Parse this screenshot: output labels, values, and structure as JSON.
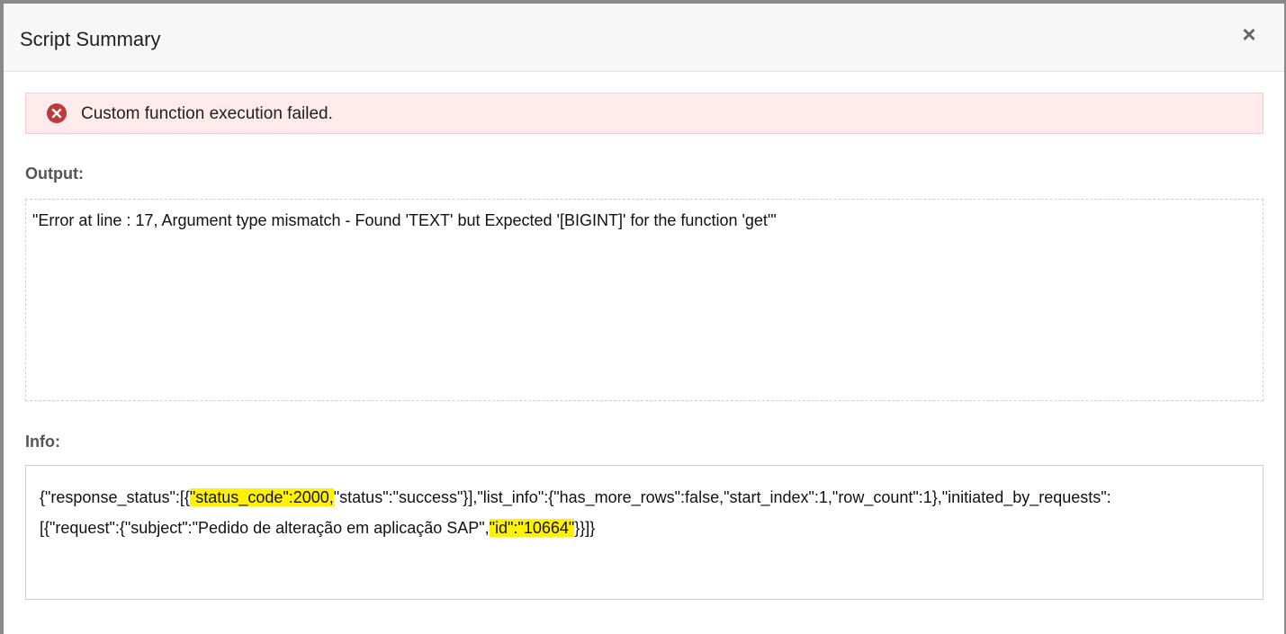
{
  "dialog": {
    "title": "Script Summary",
    "close_label": "×"
  },
  "alert": {
    "icon": "error-circle-icon",
    "message": "Custom function execution failed.",
    "color": "#c0393b"
  },
  "output": {
    "label": "Output:",
    "text": "\"Error at line : 17, Argument type mismatch - Found 'TEXT' but Expected '[BIGINT]' for the function 'get'\""
  },
  "info": {
    "label": "Info:",
    "segments": {
      "s1": "{\"response_status\":[{",
      "s2_highlight": "\"status_code\":2000,",
      "s3": "\"status\":\"success\"}],\"list_info\":{\"has_more_rows\":false,\"start_index\":1,\"row_count\":1},\"initiated_by_requests\":",
      "s4": "[{\"request\":{\"subject\":\"Pedido de alteração em aplicação SAP\",",
      "s5_highlight": "\"id\":\"10664\"",
      "s6": "}}]}"
    },
    "highlight_color": "#fff200"
  }
}
